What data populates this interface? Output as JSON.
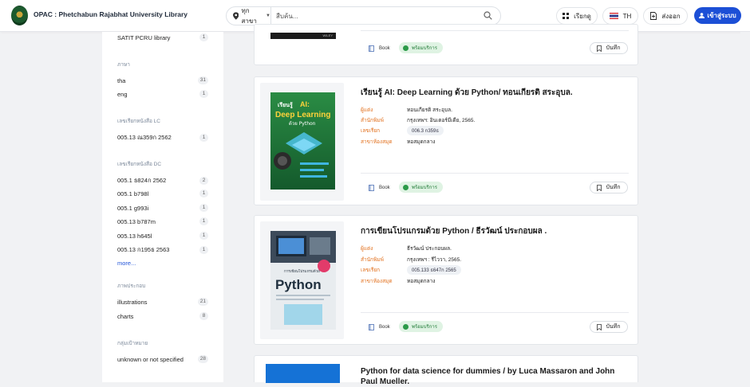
{
  "header": {
    "brand": "OPAC : Phetchabun Rajabhat University Library",
    "branch_label": "ทุกสาขา",
    "search_placeholder": "สืบค้น...",
    "browse_label": "เรียกดู",
    "language_label": "TH",
    "logout_label": "ส่งออก",
    "login_label": "เข้าสู่ระบบ"
  },
  "sidebar": {
    "top_item": {
      "label": "SATIT PCRU library",
      "count": "1"
    },
    "language": {
      "heading": "ภาษา",
      "items": [
        {
          "label": "tha",
          "count": "31"
        },
        {
          "label": "eng",
          "count": "1"
        }
      ]
    },
    "lc": {
      "heading": "เลขเรียกหนังสือ LC",
      "items": [
        {
          "label": "005.13 ณ359ก 2562",
          "count": "1"
        }
      ]
    },
    "dc": {
      "heading": "เลขเรียกหนังสือ DC",
      "items": [
        {
          "label": "005.1 ธ824ก 2562",
          "count": "2"
        },
        {
          "label": "005.1 b798l",
          "count": "1"
        },
        {
          "label": "005.1 g993i",
          "count": "1"
        },
        {
          "label": "005.13 b787m",
          "count": "1"
        },
        {
          "label": "005.13 h645l",
          "count": "1"
        },
        {
          "label": "005.13 ก195ธ 2563",
          "count": "1"
        }
      ],
      "more": "more..."
    },
    "illustration": {
      "heading": "ภาพประกอบ",
      "items": [
        {
          "label": "illustrations",
          "count": "21"
        },
        {
          "label": "charts",
          "count": "8"
        }
      ]
    },
    "audience": {
      "heading": "กลุ่มเป้าหมาย",
      "items": [
        {
          "label": "unknown or not specified",
          "count": "28"
        }
      ]
    }
  },
  "results": {
    "type_label": "Book",
    "available_label": "พร้อมบริการ",
    "save_label": "บันทึก",
    "field_labels": {
      "author": "ผู้แต่ง",
      "publisher": "สำนักพิมพ์",
      "call_number": "เลขเรียก",
      "location": "สาขาห้องสมุด"
    },
    "items": [
      {
        "title": "เรียนรู้ AI: Deep Learning ด้วย Python/ ทอนเกียรติ สระอุบล.",
        "author": "ทอนเกียรติ สระอุบล.",
        "publisher": "กรุงเทพฯ: อินเตอร์มีเดีย, 2565.",
        "call_number": "006.3 ก359ธ",
        "location": "หอสมุดกลาง",
        "cover_text": {
          "pre": "เรียนรู้",
          "main1": "AI:",
          "main2": "Deep Learning",
          "sub": "ด้วย Python"
        }
      },
      {
        "title": "การเขียนโปรแกรมด้วย Python / ธีรวัฒน์ ประกอบผล .",
        "author": "ธีรวัฒน์ ประกอบผล.",
        "publisher": "กรุงเทพฯ : รีไววา, 2565.",
        "call_number": "005.133 ธ647ก 2565",
        "location": "หอสมุดกลาง",
        "cover_text": {
          "pre": "การเขียนโปรแกรมด้วย",
          "main": "Python"
        }
      },
      {
        "title": "Python for data science for dummies / by Luca Massaron and John Paul Mueller."
      }
    ]
  },
  "colors": {
    "accent": "#1c4fd6",
    "label_orange": "#e2701d",
    "available_green": "#2b9a48"
  }
}
